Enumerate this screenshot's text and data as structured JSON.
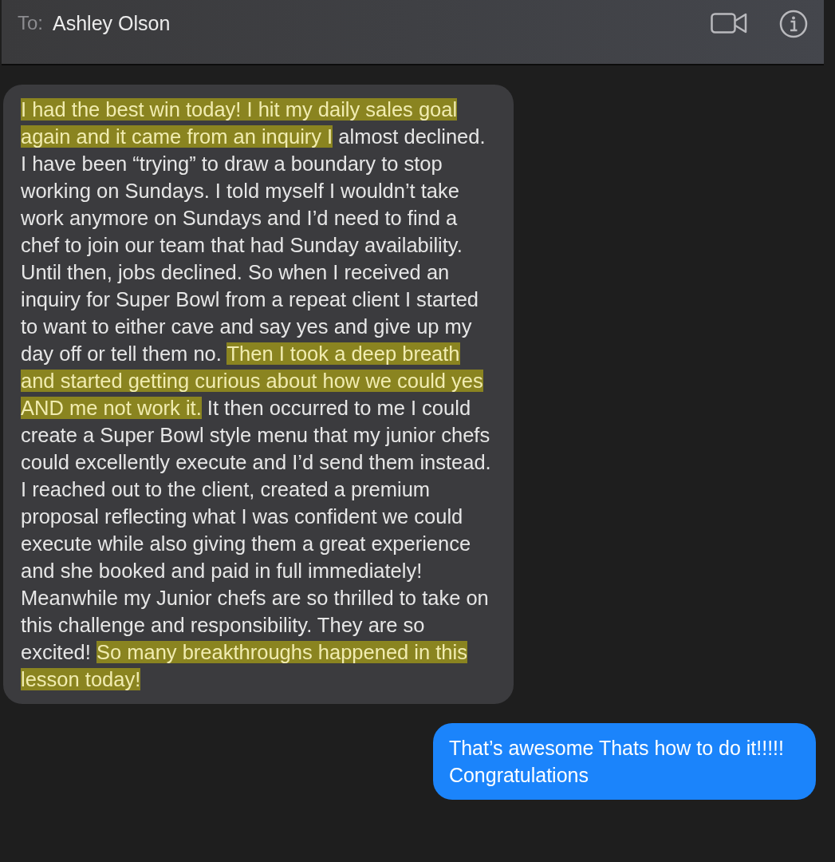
{
  "header": {
    "to_label": "To:",
    "recipient": "Ashley Olson"
  },
  "messages": [
    {
      "kind": "received",
      "segments": [
        {
          "text": "I had the best win today! I hit my daily sales goal again and it came from an inquiry I",
          "highlighted": true
        },
        {
          "text": " almost declined. I have been “trying” to draw a boundary to stop working on Sundays. I told myself I wouldn’t take work anymore on Sundays and I’d need to find a chef to join our team that had Sunday availability. Until then, jobs declined. So when I received an inquiry for Super Bowl from a repeat client I started to want to either cave and say yes and give up my day off or tell them no. ",
          "highlighted": false
        },
        {
          "text": "Then I took a deep breath and started getting curious about how we could yes AND me not work it.",
          "highlighted": true
        },
        {
          "text": " It then occurred to me I could create a Super Bowl style menu that my junior chefs could excellently execute and I’d send them instead. I reached out to the client, created a premium proposal reflecting what I was confident we could execute while also giving them a great experience and she booked and paid in full immediately! Meanwhile my Junior chefs are so thrilled to take on this challenge and responsibility. They are so excited! ",
          "highlighted": false
        },
        {
          "text": "So many breakthroughs happened in this lesson today!",
          "highlighted": true
        }
      ]
    },
    {
      "kind": "sent",
      "segments": [
        {
          "text": "That’s awesome Thats how to do it!!!!!\nCongratulations",
          "highlighted": false
        }
      ]
    }
  ]
}
